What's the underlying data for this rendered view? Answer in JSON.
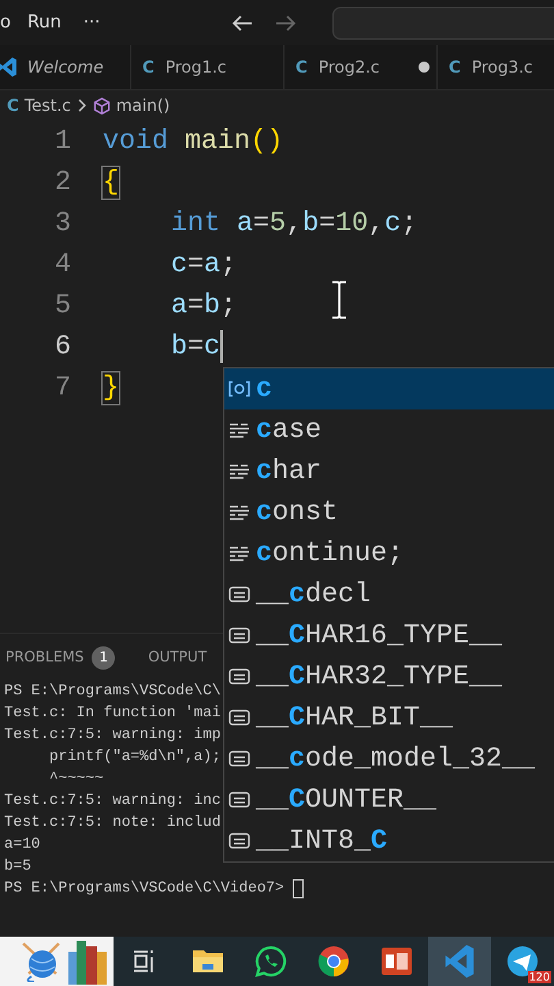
{
  "menu": {
    "items": [
      "o",
      "Run",
      "···"
    ]
  },
  "tabs": [
    {
      "label": "Welcome",
      "preview": true,
      "modified": false
    },
    {
      "icon": "C",
      "label": "Prog1.c",
      "preview": false,
      "modified": false
    },
    {
      "icon": "C",
      "label": "Prog2.c",
      "preview": false,
      "modified": true
    },
    {
      "icon": "C",
      "label": "Prog3.c",
      "preview": false
    }
  ],
  "breadcrumb": [
    {
      "kind": "file",
      "icon": "C",
      "label": "Test.c"
    },
    {
      "kind": "symbol",
      "label": "main()"
    }
  ],
  "editor": {
    "lines": [
      {
        "number": "1",
        "indented": false,
        "cursor": false,
        "tokens": [
          {
            "kind": "keyword",
            "text": "void "
          },
          {
            "kind": "function",
            "text": "main"
          },
          {
            "kind": "paren",
            "text": "()"
          }
        ]
      },
      {
        "number": "2",
        "indented": false,
        "cursor": false,
        "tokens": [
          {
            "kind": "brace",
            "text": "{"
          }
        ]
      },
      {
        "number": "3",
        "indented": true,
        "cursor": false,
        "tokens": [
          {
            "kind": "keyword",
            "text": "int "
          },
          {
            "kind": "variable",
            "text": "a"
          },
          {
            "kind": "plain",
            "text": "="
          },
          {
            "kind": "number",
            "text": "5"
          },
          {
            "kind": "plain",
            "text": ","
          },
          {
            "kind": "variable",
            "text": "b"
          },
          {
            "kind": "plain",
            "text": "="
          },
          {
            "kind": "number",
            "text": "10"
          },
          {
            "kind": "plain",
            "text": ","
          },
          {
            "kind": "variable",
            "text": "c"
          },
          {
            "kind": "plain",
            "text": ";"
          }
        ]
      },
      {
        "number": "4",
        "indented": true,
        "cursor": false,
        "tokens": [
          {
            "kind": "variable",
            "text": "c"
          },
          {
            "kind": "plain",
            "text": "="
          },
          {
            "kind": "variable",
            "text": "a"
          },
          {
            "kind": "plain",
            "text": ";"
          }
        ]
      },
      {
        "number": "5",
        "indented": true,
        "cursor": false,
        "tokens": [
          {
            "kind": "variable",
            "text": "a"
          },
          {
            "kind": "plain",
            "text": "="
          },
          {
            "kind": "variable",
            "text": "b"
          },
          {
            "kind": "plain",
            "text": ";"
          }
        ]
      },
      {
        "number": "6",
        "indented": true,
        "cursor": true,
        "tokens": [
          {
            "kind": "variable",
            "text": "b"
          },
          {
            "kind": "plain",
            "text": "="
          },
          {
            "kind": "variable",
            "text": "c"
          }
        ]
      },
      {
        "number": "7",
        "indented": false,
        "cursor": false,
        "tokens": [
          {
            "kind": "brace",
            "text": "}"
          }
        ]
      }
    ]
  },
  "suggestions": [
    {
      "kind": "variable",
      "selected": true,
      "parts": [
        {
          "text": "c",
          "match": true
        }
      ]
    },
    {
      "kind": "keyword",
      "selected": false,
      "parts": [
        {
          "text": "c",
          "match": true
        },
        {
          "text": "ase",
          "match": false
        }
      ]
    },
    {
      "kind": "keyword",
      "selected": false,
      "parts": [
        {
          "text": "c",
          "match": true
        },
        {
          "text": "har",
          "match": false
        }
      ]
    },
    {
      "kind": "keyword",
      "selected": false,
      "parts": [
        {
          "text": "c",
          "match": true
        },
        {
          "text": "onst",
          "match": false
        }
      ]
    },
    {
      "kind": "keyword",
      "selected": false,
      "parts": [
        {
          "text": "c",
          "match": true
        },
        {
          "text": "ontinue;",
          "match": false
        }
      ]
    },
    {
      "kind": "text",
      "selected": false,
      "parts": [
        {
          "text": "__",
          "match": false
        },
        {
          "text": "c",
          "match": true
        },
        {
          "text": "decl",
          "match": false
        }
      ]
    },
    {
      "kind": "text",
      "selected": false,
      "parts": [
        {
          "text": "__",
          "match": false
        },
        {
          "text": "C",
          "match": true
        },
        {
          "text": "HAR16_TYPE__",
          "match": false
        }
      ]
    },
    {
      "kind": "text",
      "selected": false,
      "parts": [
        {
          "text": "__",
          "match": false
        },
        {
          "text": "C",
          "match": true
        },
        {
          "text": "HAR32_TYPE__",
          "match": false
        }
      ]
    },
    {
      "kind": "text",
      "selected": false,
      "parts": [
        {
          "text": "__",
          "match": false
        },
        {
          "text": "C",
          "match": true
        },
        {
          "text": "HAR_BIT__",
          "match": false
        }
      ]
    },
    {
      "kind": "text",
      "selected": false,
      "parts": [
        {
          "text": "__",
          "match": false
        },
        {
          "text": "c",
          "match": true
        },
        {
          "text": "ode_model_32__",
          "match": false
        }
      ]
    },
    {
      "kind": "text",
      "selected": false,
      "parts": [
        {
          "text": "__",
          "match": false
        },
        {
          "text": "C",
          "match": true
        },
        {
          "text": "OUNTER__",
          "match": false
        }
      ]
    },
    {
      "kind": "text",
      "selected": false,
      "parts": [
        {
          "text": "__INT8_",
          "match": false
        },
        {
          "text": "C",
          "match": true
        }
      ]
    }
  ],
  "panel": {
    "tabs": [
      {
        "label": "PROBLEMS",
        "badge": "1"
      },
      {
        "label": "OUTPUT"
      }
    ],
    "terminal": {
      "lines": [
        "PS E:\\Programs\\VSCode\\C\\",
        "Test.c: In function 'mai",
        "Test.c:7:5: warning: imp",
        "     printf(\"a=%d\\n\",a);",
        "     ^~~~~~",
        "Test.c:7:5: warning: inc",
        "Test.c:7:5: note: includ",
        "a=10",
        "b=5"
      ],
      "prompt": "PS E:\\Programs\\VSCode\\C\\Video7> ",
      "cursor": true
    }
  },
  "taskbar": {
    "items": [
      {
        "kind": "taskview",
        "selected": false
      },
      {
        "kind": "folder",
        "selected": false
      },
      {
        "kind": "chat",
        "selected": false
      },
      {
        "kind": "browser",
        "selected": false
      },
      {
        "kind": "slides",
        "selected": false
      },
      {
        "kind": "editor",
        "selected": true
      },
      {
        "kind": "messenger",
        "selected": false,
        "badge": "120"
      }
    ]
  }
}
